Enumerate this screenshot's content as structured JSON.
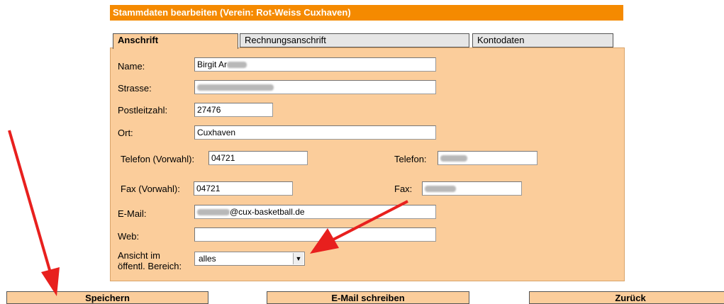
{
  "header": {
    "title": "Stammdaten  bearbeiten (Verein: Rot-Weiss Cuxhaven)"
  },
  "tabs": [
    {
      "label": "Anschrift",
      "active": true
    },
    {
      "label": "Rechnungsanschrift",
      "active": false
    },
    {
      "label": "Kontodaten",
      "active": false
    }
  ],
  "form": {
    "name_label": "Name:",
    "name_value": "Birgit Ar",
    "strasse_label": "Strasse:",
    "plz_label": "Postleitzahl:",
    "plz_value": "27476",
    "ort_label": "Ort:",
    "ort_value": "Cuxhaven",
    "telefon_vorwahl_label": "Telefon (Vorwahl):",
    "telefon_vorwahl_value": "04721",
    "telefon_label": "Telefon:",
    "fax_vorwahl_label": "Fax (Vorwahl):",
    "fax_vorwahl_value": "04721",
    "fax_label": "Fax:",
    "email_label": "E-Mail:",
    "email_domain": "@cux-basketball.de",
    "web_label": "Web:",
    "web_value": "",
    "ansicht_label_line1": "Ansicht im",
    "ansicht_label_line2": "öffentl. Bereich:",
    "ansicht_value": "alles"
  },
  "buttons": {
    "save": "Speichern",
    "email": "E-Mail schreiben",
    "back": "Zurück"
  },
  "colors": {
    "accent": "#f58a00",
    "panel": "#fbcd9b",
    "annotation_arrow": "#e8201e"
  }
}
